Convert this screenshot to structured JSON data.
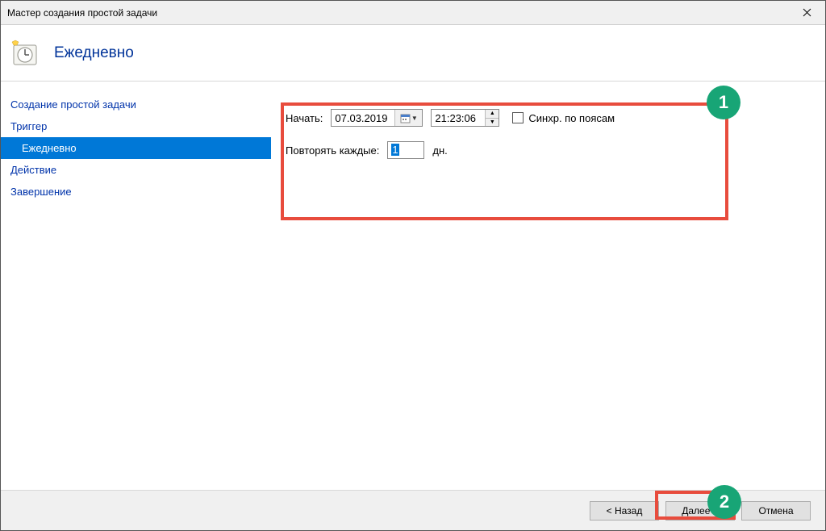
{
  "title": "Мастер создания простой задачи",
  "header": "Ежедневно",
  "sidebar": {
    "items": [
      {
        "label": "Создание простой задачи"
      },
      {
        "label": "Триггер"
      },
      {
        "label": "Ежедневно"
      },
      {
        "label": "Действие"
      },
      {
        "label": "Завершение"
      }
    ]
  },
  "form": {
    "start_label": "Начать:",
    "date_value": "07.03.2019",
    "time_value": "21:23:06",
    "sync_label": "Синхр. по поясам",
    "repeat_label": "Повторять каждые:",
    "repeat_value": "1",
    "repeat_unit": "дн."
  },
  "footer": {
    "back": "< Назад",
    "next": "Далее >",
    "cancel": "Отмена"
  },
  "annotations": {
    "badge1": "1",
    "badge2": "2"
  }
}
